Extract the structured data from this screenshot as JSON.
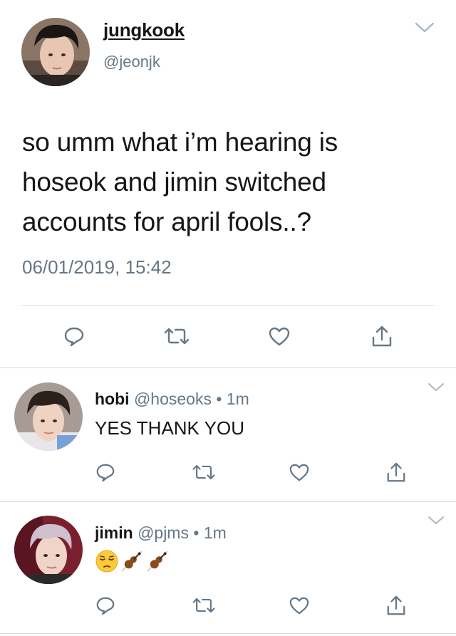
{
  "main_tweet": {
    "display_name": "jungkook",
    "handle": "@jeonjk",
    "text": "so umm what i’m hearing is hoseok and jimin switched accounts for april fools..?",
    "timestamp": "06/01/2019, 15:42",
    "avatar_icon": "avatar-photo",
    "menu_icon": "chevron-down-icon"
  },
  "replies": [
    {
      "display_name": "hobi",
      "handle": "@hoseoks",
      "separator": "•",
      "time": "1m",
      "text": "YES THANK YOU"
    },
    {
      "display_name": "jimin",
      "handle": "@pjms",
      "separator": "•",
      "time": "1m",
      "text": "",
      "emojis": [
        "pensive-face",
        "violin",
        "violin"
      ]
    }
  ],
  "actions": [
    "reply-icon",
    "retweet-icon",
    "like-icon",
    "share-icon"
  ],
  "colors": {
    "text": "#14171a",
    "secondary": "#657786",
    "icon": "#657786",
    "divider": "#d8dfe4"
  }
}
